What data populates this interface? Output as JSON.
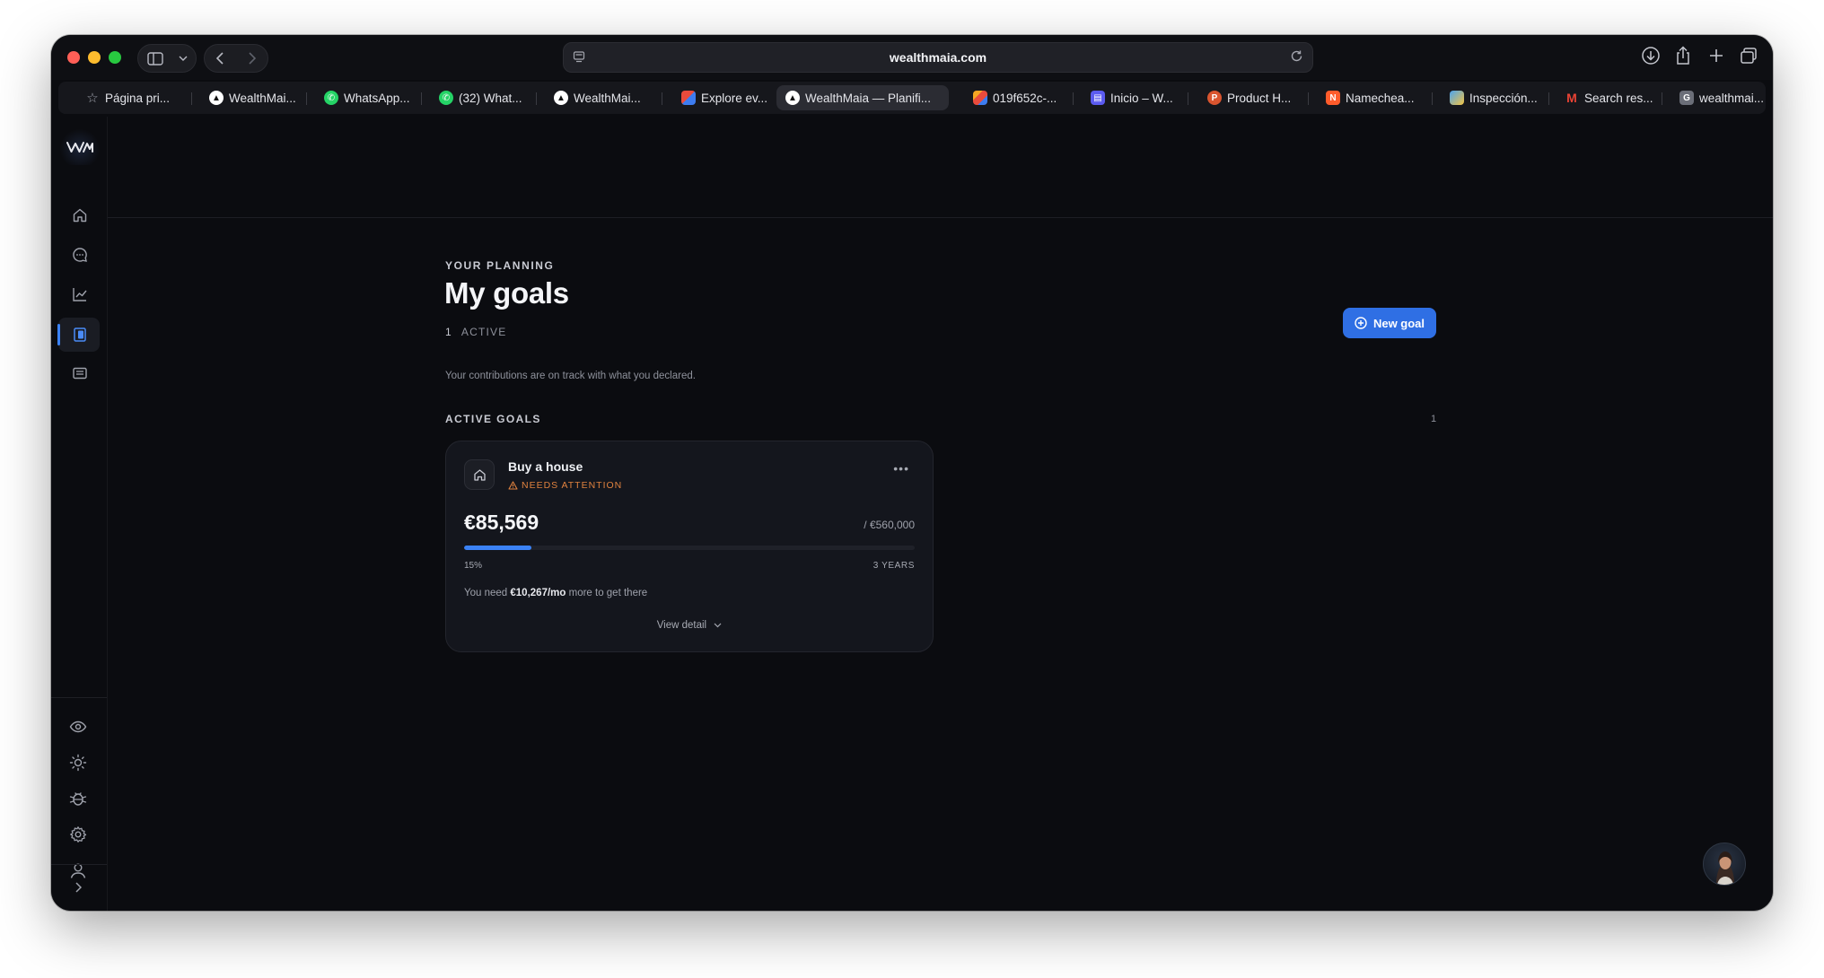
{
  "browser": {
    "url": "wealthmaia.com",
    "bookmarks": [
      {
        "label": "Página pri...",
        "icon": "star-icon",
        "color": "#9ea1ab"
      },
      {
        "label": "WealthMai...",
        "icon": "wealthmaia-icon",
        "color": "#ffffff"
      },
      {
        "label": "WhatsApp...",
        "icon": "whatsapp-icon",
        "color": "#25d366"
      },
      {
        "label": "(32) What...",
        "icon": "whatsapp-icon",
        "color": "#25d366"
      },
      {
        "label": "WealthMai...",
        "icon": "wealthmaia-icon",
        "color": "#ffffff"
      },
      {
        "label": "Explore ev...",
        "icon": "explore-icon",
        "color": "#e94b3c"
      },
      {
        "label": "WealthMaia — Planifi...",
        "icon": "wealthmaia-icon",
        "color": "#ffffff",
        "active": true
      },
      {
        "label": "019f652c-...",
        "icon": "colorful-icon",
        "color": "#f5a623"
      },
      {
        "label": "Inicio – W...",
        "icon": "inicio-icon",
        "color": "#5b5bf0"
      },
      {
        "label": "Product H...",
        "icon": "product-hunt-icon",
        "color": "#da552f"
      },
      {
        "label": "Namechea...",
        "icon": "namecheap-icon",
        "color": "#ff5c2b"
      },
      {
        "label": "Inspección...",
        "icon": "chart-icon",
        "color": "#4aa3f0"
      },
      {
        "label": "Search res...",
        "icon": "gmail-icon",
        "color": "#ea4335"
      },
      {
        "label": "wealthmai...",
        "icon": "google-icon",
        "color": "#6b6e78"
      }
    ]
  },
  "page": {
    "eyebrow": "YOUR PLANNING",
    "title": "My goals",
    "active_count": "1",
    "active_label": "ACTIVE",
    "summary": "Your contributions are on track with what you declared.",
    "new_goal_label": "New goal",
    "section_label": "ACTIVE GOALS",
    "section_count": "1"
  },
  "goal": {
    "title": "Buy a house",
    "status": "NEEDS ATTENTION",
    "amount": "€85,569",
    "target": "/ €560,000",
    "progress_percent": 15,
    "progress_label": "15%",
    "horizon": "3 YEARS",
    "need_prefix": "You need",
    "need_amount": "€10,267/mo",
    "need_suffix": "more to get there",
    "view_detail": "View detail"
  },
  "colors": {
    "accent": "#3b82f6",
    "warning": "#e0823f",
    "background": "#0b0c10"
  }
}
